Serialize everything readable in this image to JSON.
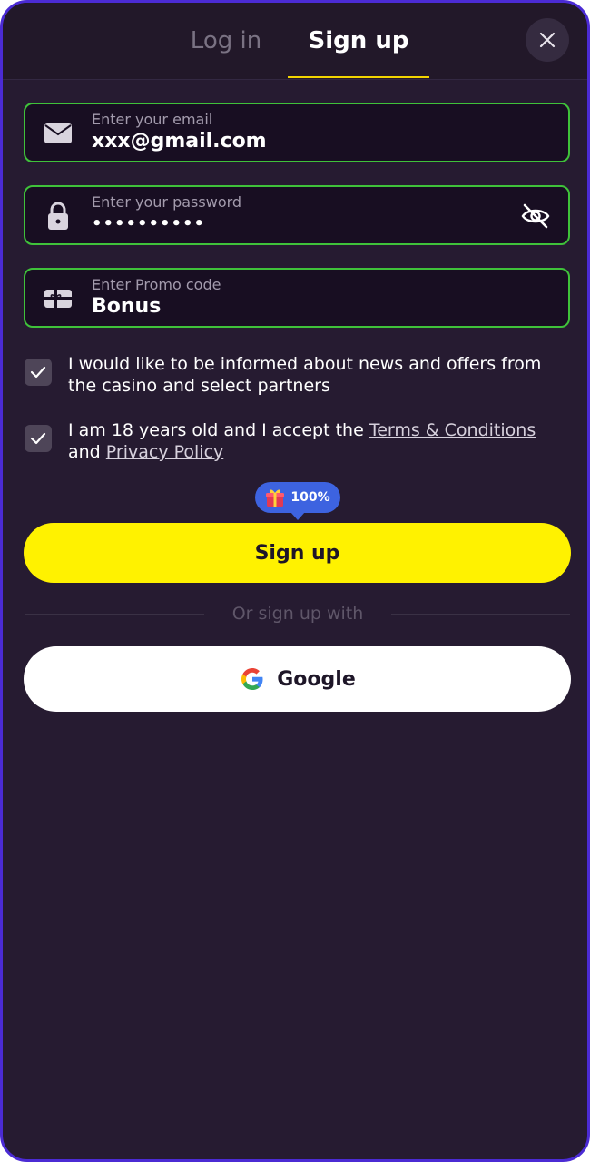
{
  "tabs": {
    "login": "Log in",
    "signup": "Sign up"
  },
  "form": {
    "email": {
      "label": "Enter your email",
      "value": "xxx@gmail.com"
    },
    "password": {
      "label": "Enter your password",
      "value": "••••••••••"
    },
    "promo": {
      "label": "Enter Promo code",
      "value": "Bonus"
    }
  },
  "consents": {
    "news": {
      "text": "I would like to be informed about news and offers from the casino and select partners"
    },
    "terms": {
      "prefix": "I am 18 years old and I accept the ",
      "terms_link": "Terms & Conditions",
      "and": " and ",
      "privacy_link": "Privacy Policy"
    }
  },
  "bonus": {
    "percent": "100%"
  },
  "buttons": {
    "signup": "Sign up",
    "google": "Google"
  },
  "divider": "Or sign up with",
  "icons": [
    "close-icon",
    "mail-icon",
    "lock-icon",
    "eye-off-icon",
    "gift-card-icon",
    "check-icon",
    "gift-icon",
    "google-icon"
  ],
  "colors": {
    "accent_yellow": "#fff200",
    "field_border": "#3fc23a",
    "frame_border": "#4b2bd4",
    "badge_blue": "#3d63e0"
  }
}
